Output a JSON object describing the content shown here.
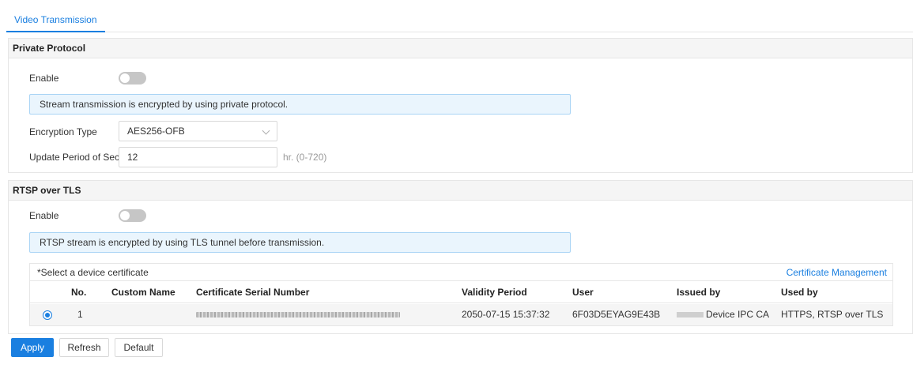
{
  "tabs": [
    {
      "label": "Video Transmission",
      "active": true
    }
  ],
  "private_protocol": {
    "title": "Private Protocol",
    "enable_label": "Enable",
    "enabled": false,
    "info": "Stream transmission is encrypted by using private protocol.",
    "encryption_type_label": "Encryption Type",
    "encryption_type_value": "AES256-OFB",
    "update_period_label": "Update Period of Sec...",
    "update_period_value": "12",
    "update_period_hint": "hr. (0-720)"
  },
  "rtsp_over_tls": {
    "title": "RTSP over TLS",
    "enable_label": "Enable",
    "enabled": false,
    "info": "RTSP stream is encrypted by using TLS tunnel before transmission.",
    "cert_select_label": "*Select a device certificate",
    "cert_management_link": "Certificate Management",
    "columns": [
      "No.",
      "Custom Name",
      "Certificate Serial Number",
      "Validity Period",
      "User",
      "Issued by",
      "Used by"
    ],
    "rows": [
      {
        "selected": true,
        "no": "1",
        "custom_name": "",
        "serial": "",
        "validity": "2050-07-15 15:37:32",
        "user": "6F03D5EYAG9E43B",
        "issued_by": "Device IPC CA",
        "used_by": "HTTPS, RTSP over TLS"
      }
    ]
  },
  "buttons": {
    "apply": "Apply",
    "refresh": "Refresh",
    "default": "Default"
  },
  "colors": {
    "accent": "#1a7fe0",
    "info_bg": "#eaf5fd",
    "info_border": "#a9d4f5",
    "switch_off": "#c6c6c6"
  }
}
